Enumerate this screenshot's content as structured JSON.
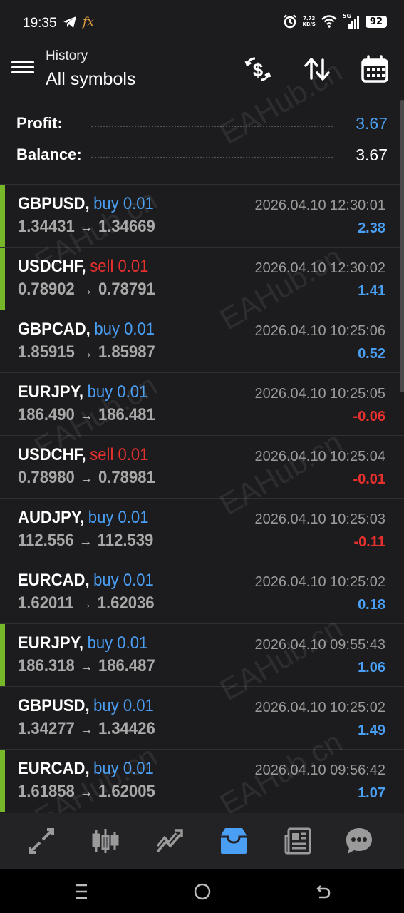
{
  "status_bar": {
    "time": "19:35",
    "fx_label": "fx",
    "net_speed_top": "7.73",
    "net_speed_unit": "KB/S",
    "network": "5G",
    "battery": "92"
  },
  "header": {
    "subtitle": "History",
    "title": "All symbols"
  },
  "summary": {
    "profit_label": "Profit:",
    "profit_value": "3.67",
    "balance_label": "Balance:",
    "balance_value": "3.67"
  },
  "deals": [
    {
      "symbol": "GBPUSD,",
      "side": "buy 0.01",
      "type": "buy",
      "open": "1.34431",
      "close": "1.34669",
      "datetime": "2026.04.10 12:30:01",
      "profit": "2.38",
      "sign": "pos",
      "marker": true
    },
    {
      "symbol": "USDCHF,",
      "side": "sell 0.01",
      "type": "sell",
      "open": "0.78902",
      "close": "0.78791",
      "datetime": "2026.04.10 12:30:02",
      "profit": "1.41",
      "sign": "pos",
      "marker": true
    },
    {
      "symbol": "GBPCAD,",
      "side": "buy 0.01",
      "type": "buy",
      "open": "1.85915",
      "close": "1.85987",
      "datetime": "2026.04.10 10:25:06",
      "profit": "0.52",
      "sign": "pos",
      "marker": false
    },
    {
      "symbol": "EURJPY,",
      "side": "buy 0.01",
      "type": "buy",
      "open": "186.490",
      "close": "186.481",
      "datetime": "2026.04.10 10:25:05",
      "profit": "-0.06",
      "sign": "neg",
      "marker": false
    },
    {
      "symbol": "USDCHF,",
      "side": "sell 0.01",
      "type": "sell",
      "open": "0.78980",
      "close": "0.78981",
      "datetime": "2026.04.10 10:25:04",
      "profit": "-0.01",
      "sign": "neg",
      "marker": false
    },
    {
      "symbol": "AUDJPY,",
      "side": "buy 0.01",
      "type": "buy",
      "open": "112.556",
      "close": "112.539",
      "datetime": "2026.04.10 10:25:03",
      "profit": "-0.11",
      "sign": "neg",
      "marker": false
    },
    {
      "symbol": "EURCAD,",
      "side": "buy 0.01",
      "type": "buy",
      "open": "1.62011",
      "close": "1.62036",
      "datetime": "2026.04.10 10:25:02",
      "profit": "0.18",
      "sign": "pos",
      "marker": false
    },
    {
      "symbol": "EURJPY,",
      "side": "buy 0.01",
      "type": "buy",
      "open": "186.318",
      "close": "186.487",
      "datetime": "2026.04.10 09:55:43",
      "profit": "1.06",
      "sign": "pos",
      "marker": true
    },
    {
      "symbol": "GBPUSD,",
      "side": "buy 0.01",
      "type": "buy",
      "open": "1.34277",
      "close": "1.34426",
      "datetime": "2026.04.10 10:25:02",
      "profit": "1.49",
      "sign": "pos",
      "marker": false
    },
    {
      "symbol": "EURCAD,",
      "side": "buy 0.01",
      "type": "buy",
      "open": "1.61858",
      "close": "1.62005",
      "datetime": "2026.04.10 09:56:42",
      "profit": "1.07",
      "sign": "pos",
      "marker": true
    }
  ],
  "arrow_glyph": "→",
  "watermark_text": "EAHub.cn",
  "colors": {
    "buy": "#4a9ff5",
    "sell": "#e8302e",
    "positive": "#4a9ff5",
    "negative": "#e8302e",
    "marker": "#76b82a",
    "active_tab": "#4a9ff5"
  },
  "nav_icons": [
    "quotes-icon",
    "chart-icon",
    "trade-icon",
    "history-icon",
    "news-icon",
    "messages-icon"
  ]
}
